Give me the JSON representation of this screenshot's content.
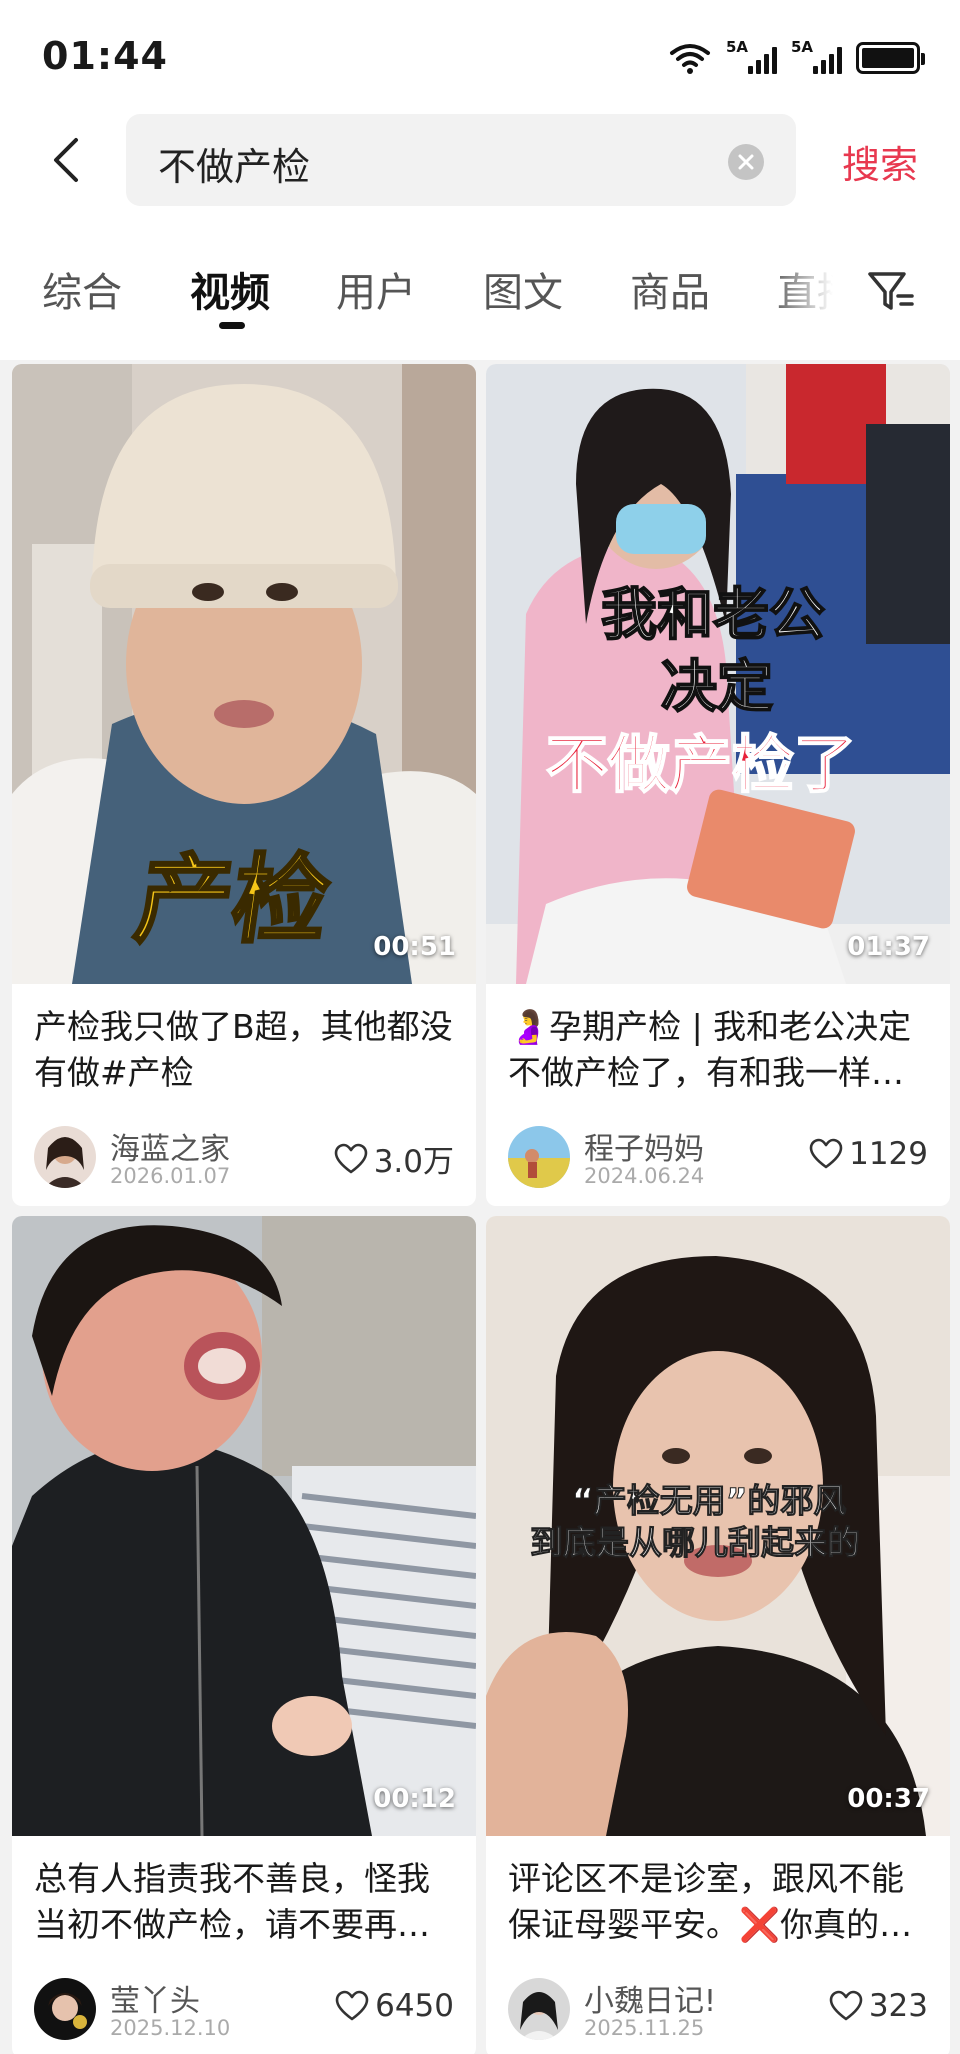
{
  "status_bar": {
    "time": "01:44",
    "signal1_label": "5A",
    "signal2_label": "5A"
  },
  "search": {
    "query": "不做产检",
    "submit_label": "搜索"
  },
  "tabs": [
    {
      "label": "综合",
      "active": false
    },
    {
      "label": "视频",
      "active": true
    },
    {
      "label": "用户",
      "active": false
    },
    {
      "label": "图文",
      "active": false
    },
    {
      "label": "商品",
      "active": false
    },
    {
      "label": "直播",
      "active": false
    }
  ],
  "icons": {
    "back": "chevron-left-icon",
    "clear": "clear-circle-icon",
    "filter": "filter-icon",
    "like": "heart-outline-icon"
  },
  "colors": {
    "accent": "#e8384f",
    "overlay_yellow": "#f5c518",
    "overlay_red": "#e8213a"
  },
  "videos": [
    {
      "duration": "00:51",
      "overlay": [
        "产检"
      ],
      "title": "产检我只做了B超，其他都没有做#产检",
      "author": "海蓝之家",
      "date": "2026.01.07",
      "likes": "3.0万"
    },
    {
      "duration": "01:37",
      "overlay": [
        "我和老公",
        "决定",
        "不做产检了"
      ],
      "title": "🤰孕期产检 | 我和老公决定不做产检了，有和我一样的吗",
      "author": "程子妈妈",
      "date": "2024.06.24",
      "likes": "1129"
    },
    {
      "duration": "00:12",
      "overlay": [],
      "title": "总有人指责我不善良，怪我当初不做产检，请不要再说了",
      "author": "莹丫头",
      "date": "2025.12.10",
      "likes": "6450"
    },
    {
      "duration": "00:37",
      "overlay": [
        "“产检无用”的邪风",
        "到底是从哪儿刮起来的"
      ],
      "title": "评论区不是诊室，跟风不能保证母婴平安。❌你真的了解吗",
      "author": "小魏日记!",
      "date": "2025.11.25",
      "likes": "323"
    }
  ]
}
